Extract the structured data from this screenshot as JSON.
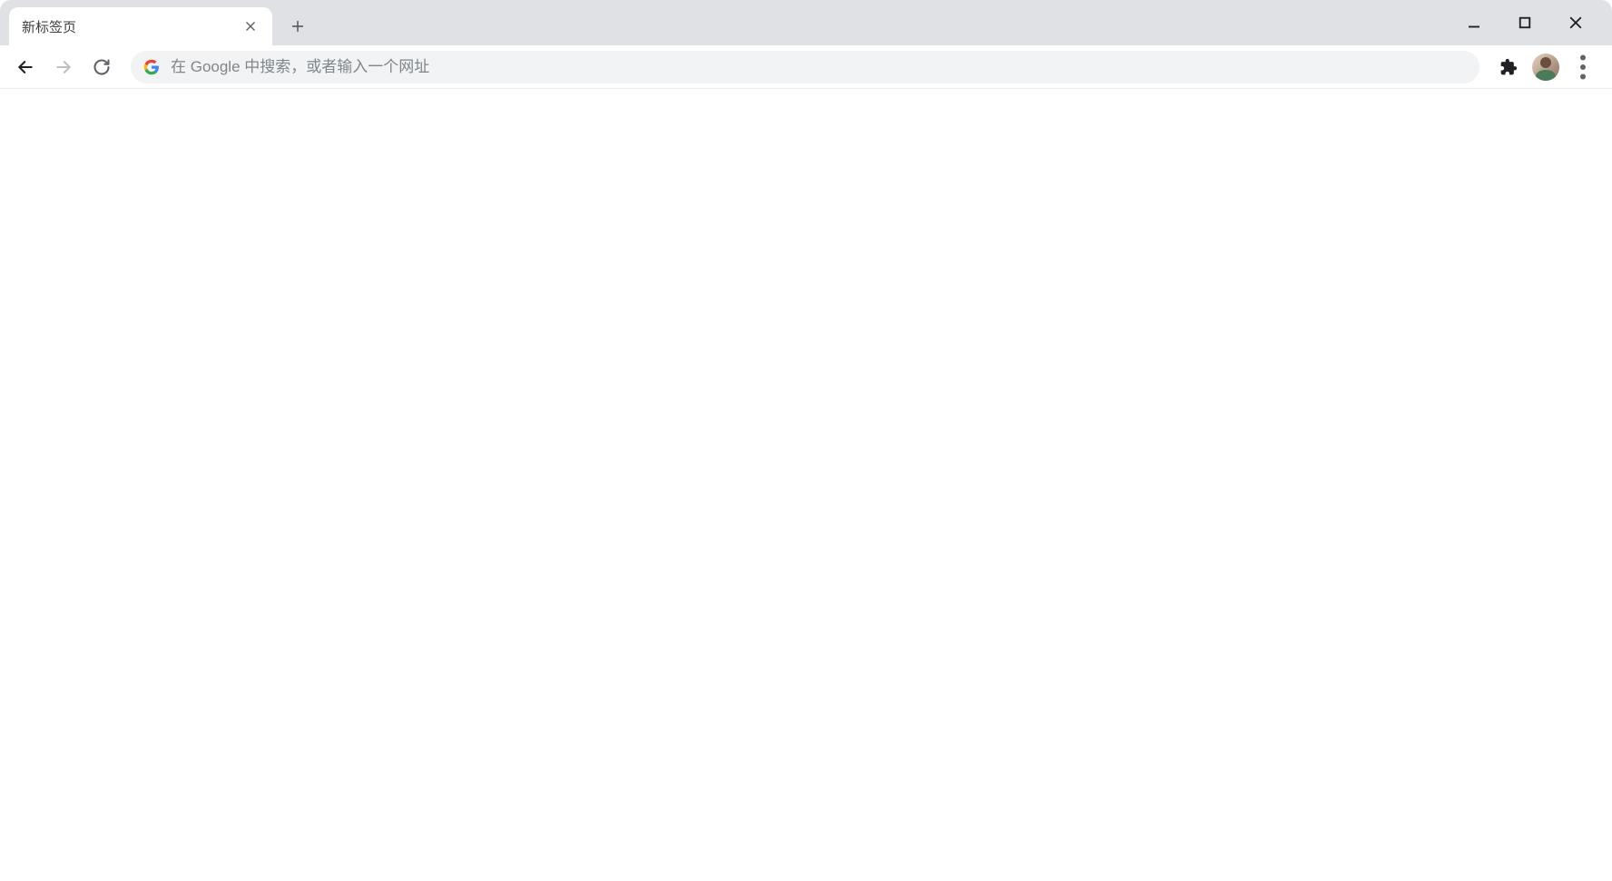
{
  "tab": {
    "title": "新标签页"
  },
  "omnibox": {
    "placeholder": "在 Google 中搜索，或者输入一个网址",
    "value": ""
  }
}
